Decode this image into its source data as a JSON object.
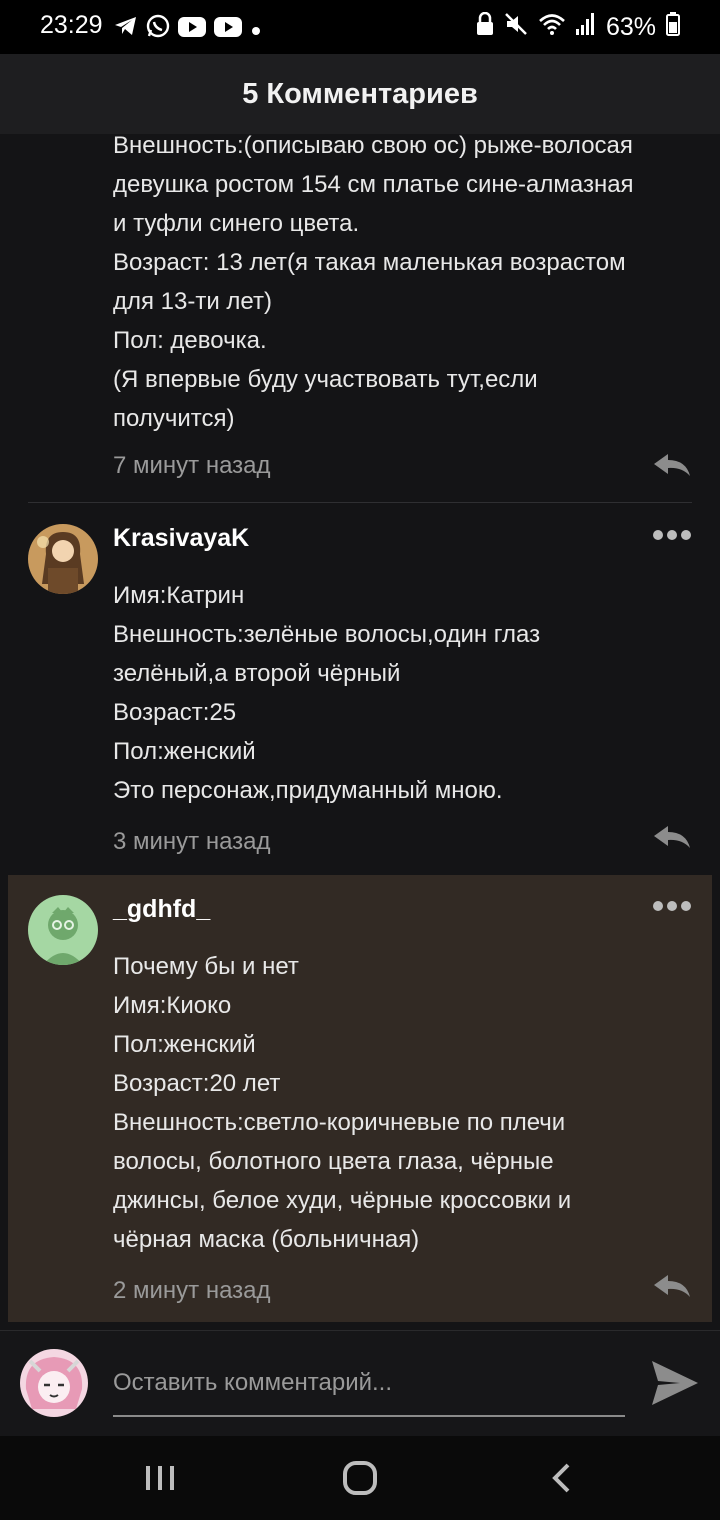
{
  "status_bar": {
    "time": "23:29",
    "battery": "63%",
    "left_icons": [
      "telegram-icon",
      "whatsapp-icon",
      "youtube-icon",
      "youtube-icon",
      "dot-icon"
    ],
    "right_icons": [
      "lock-icon",
      "mute-icon",
      "wifi-icon",
      "signal-icon",
      "battery-icon"
    ]
  },
  "header": {
    "title": "5 Комментариев"
  },
  "comments": [
    {
      "author": "",
      "lines": [
        "Внешность:(описываю свою ос) рыже-волосая",
        "девушка ростом 154 см платье сине-алмазная",
        "и туфли синего цвета.",
        "Возраст: 13 лет(я такая маленькая возрастом",
        "для 13-ти лет)",
        "Пол: девочка.",
        "(Я впервые буду участвовать тут,если",
        "получится)"
      ],
      "time_ago": "7 минут назад"
    },
    {
      "author": "KrasivayaK",
      "lines": [
        "Имя:Катрин",
        "Внешность:зелёные волосы,один глаз",
        "зелёный,а второй чёрный",
        "Возраст:25",
        "Пол:женский",
        "Это персонаж,придуманный мною."
      ],
      "time_ago": "3 минут назад"
    },
    {
      "author": "_gdhfd_",
      "lines": [
        "Почему бы и нет",
        "Имя:Киоко",
        "Пол:женский",
        "Возраст:20 лет",
        "Внешность:светло-коричневые по плечи",
        "волосы, болотного цвета глаза, чёрные",
        "джинсы, белое худи, чёрные кроссовки и",
        "чёрная маска (больничная)"
      ],
      "time_ago": "2 минут назад"
    }
  ],
  "composer": {
    "placeholder": "Оставить комментарий..."
  },
  "nav_bar": {
    "buttons": [
      "recents-icon",
      "home-icon",
      "back-icon"
    ]
  },
  "colors": {
    "background": "#141416",
    "header": "#1e1e20",
    "highlight": "#322a24",
    "muted_text": "#9a9a9a"
  }
}
